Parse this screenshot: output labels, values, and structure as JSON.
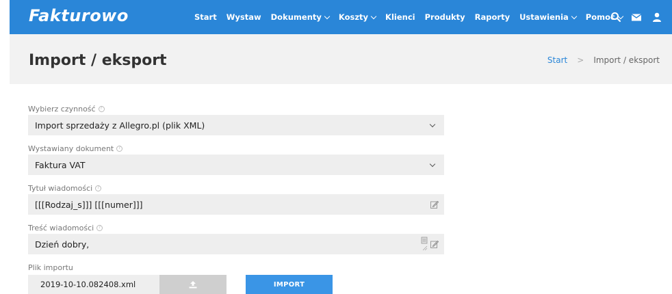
{
  "app": {
    "logo": "Fakturowo"
  },
  "nav": {
    "items": [
      {
        "label": "Start",
        "dropdown": false
      },
      {
        "label": "Wystaw",
        "dropdown": false
      },
      {
        "label": "Dokumenty",
        "dropdown": true
      },
      {
        "label": "Koszty",
        "dropdown": true
      },
      {
        "label": "Klienci",
        "dropdown": false
      },
      {
        "label": "Produkty",
        "dropdown": false
      },
      {
        "label": "Raporty",
        "dropdown": false
      },
      {
        "label": "Ustawienia",
        "dropdown": true
      },
      {
        "label": "Pomoc",
        "dropdown": true
      }
    ],
    "icons": [
      "search-icon",
      "mail-icon",
      "user-icon"
    ]
  },
  "header": {
    "title": "Import / eksport",
    "breadcrumb": {
      "home": "Start",
      "separator": ">",
      "current": "Import / eksport"
    }
  },
  "form": {
    "action": {
      "label": "Wybierz czynność",
      "value": "Import sprzedaży z Allegro.pl (plik XML)"
    },
    "document": {
      "label": "Wystawiany dokument",
      "value": "Faktura VAT"
    },
    "subject": {
      "label": "Tytuł wiadomości",
      "value": "[[[Rodzaj_s]]] [[[numer]]]"
    },
    "body": {
      "label": "Treść wiadomości",
      "value": "Dzień dobry,"
    },
    "file": {
      "label": "Plik importu",
      "filename": "2019-10-10.082408.xml",
      "button_icon": "upload-icon"
    },
    "import_button": "IMPORT"
  },
  "colors": {
    "brand": "#2a86d8",
    "button": "#3a95e6",
    "field_bg": "#eeeeee",
    "header_bg": "#f2f2f2"
  }
}
